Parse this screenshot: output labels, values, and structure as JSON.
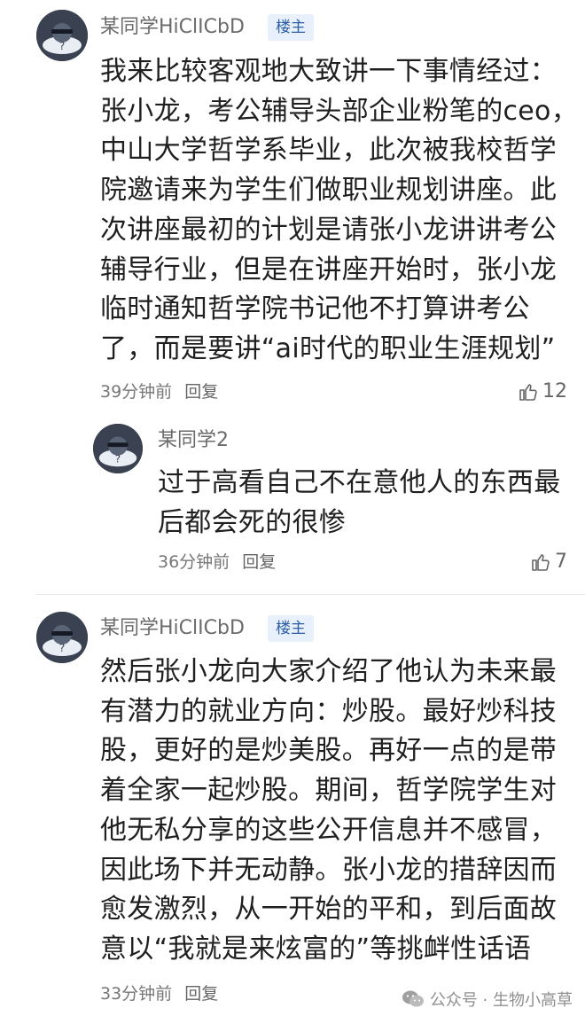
{
  "comments": [
    {
      "username": "某同学HiClICbD",
      "badge": "楼主",
      "lines": [
        "我来比较客观地大致讲一下事情经过：",
        "张小龙，考公辅导头部企业粉笔的ceo，",
        "中山大学哲学系毕业，此次被我校哲学",
        "院邀请来为学生们做职业规划讲座。此",
        "次讲座最初的计划是请张小龙讲讲考公",
        "辅导行业，但是在讲座开始时，张小龙",
        "临时通知哲学院书记他不打算讲考公",
        "了，而是要讲“ai时代的职业生涯规划”"
      ],
      "time": "39分钟前",
      "reply_label": "回复",
      "likes": "12"
    },
    {
      "username": "某同学2",
      "lines": [
        "过于高看自己不在意他人的东西最",
        "后都会死的很惨"
      ],
      "time": "36分钟前",
      "reply_label": "回复",
      "likes": "7"
    },
    {
      "username": "某同学HiClICbD",
      "badge": "楼主",
      "lines": [
        "然后张小龙向大家介绍了他认为未来最",
        "有潜力的就业方向：炒股。最好炒科技",
        "股，更好的是炒美股。再好一点的是带",
        "着全家一起炒股。期间，哲学院学生对",
        "他无私分享的这些公开信息并不感冒，",
        "因此场下并无动静。张小龙的措辞因而",
        "愈发激烈，从一开始的平和，到后面故",
        "意以“我就是来炫富的”等挑衅性话语"
      ],
      "time": "33分钟前",
      "reply_label": "回复"
    }
  ],
  "watermark": {
    "text": "公众号 · 生物小高草"
  },
  "icons": {
    "like": "thumbs-up-icon",
    "watermark": "wechat-icon",
    "avatar": "anonymous-avatar-icon"
  }
}
